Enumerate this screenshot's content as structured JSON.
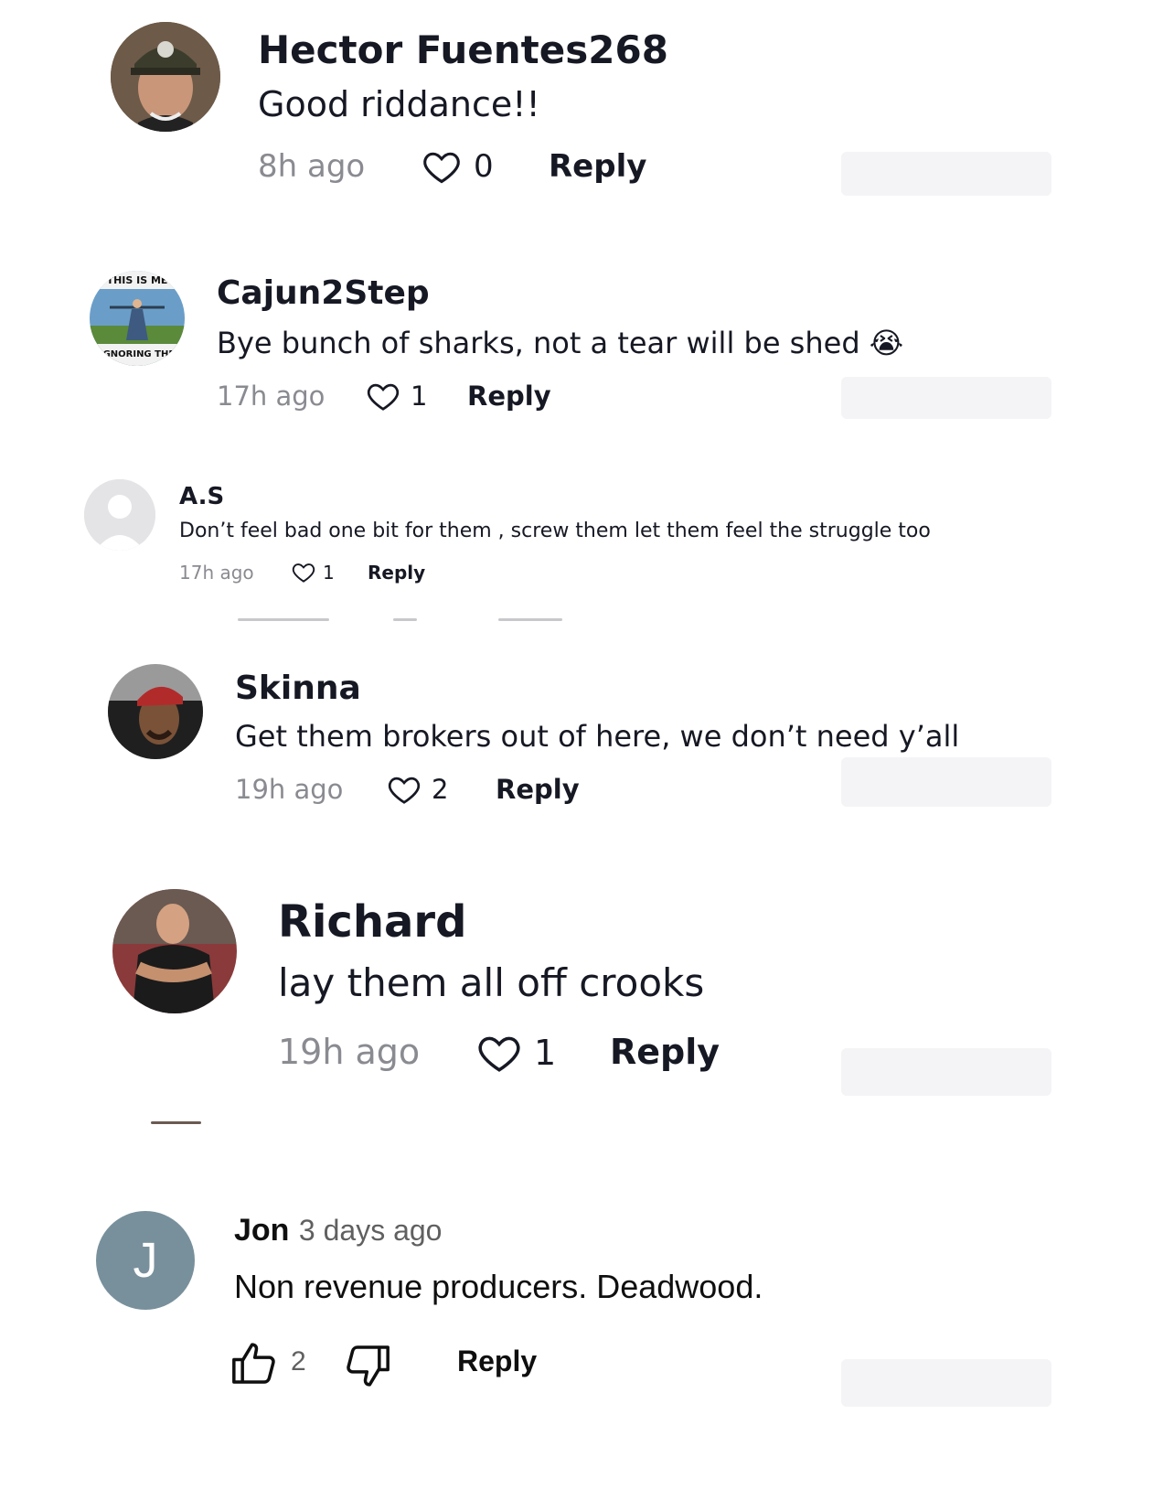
{
  "comments": [
    {
      "username": "Hector Fuentes268",
      "text": "Good riddance!!",
      "time": "8h ago",
      "likes": "0",
      "reply": "Reply",
      "avatar_icon": "profile-photo"
    },
    {
      "username": "Cajun2Step",
      "text": "Bye bunch of sharks, not a tear will be shed 😭",
      "time": "17h ago",
      "likes": "1",
      "reply": "Reply",
      "avatar_icon": "meme-profile-image"
    },
    {
      "username": "A.S",
      "text": "Don’t feel bad one bit for them , screw them let them feel the struggle too",
      "time": "17h ago",
      "likes": "1",
      "reply": "Reply",
      "avatar_icon": "default-user-icon"
    },
    {
      "username": "Skinna",
      "text": "Get them brokers out of here, we don’t need y’all",
      "time": "19h ago",
      "likes": "2",
      "reply": "Reply",
      "avatar_icon": "profile-photo"
    },
    {
      "username": "Richard",
      "text": "lay them all off crooks",
      "time": "19h ago",
      "likes": "1",
      "reply": "Reply",
      "avatar_icon": "profile-photo"
    },
    {
      "username": "Jon",
      "time": "3 days ago",
      "text": "Non revenue producers.  Deadwood.",
      "likes": "2",
      "reply": "Reply",
      "avatar_letter": "J",
      "avatar_color": "#78909c"
    }
  ],
  "colors": {
    "primary_text": "#161823",
    "secondary_text": "#8a8b91",
    "avatar_letter_bg": "#78909c"
  }
}
